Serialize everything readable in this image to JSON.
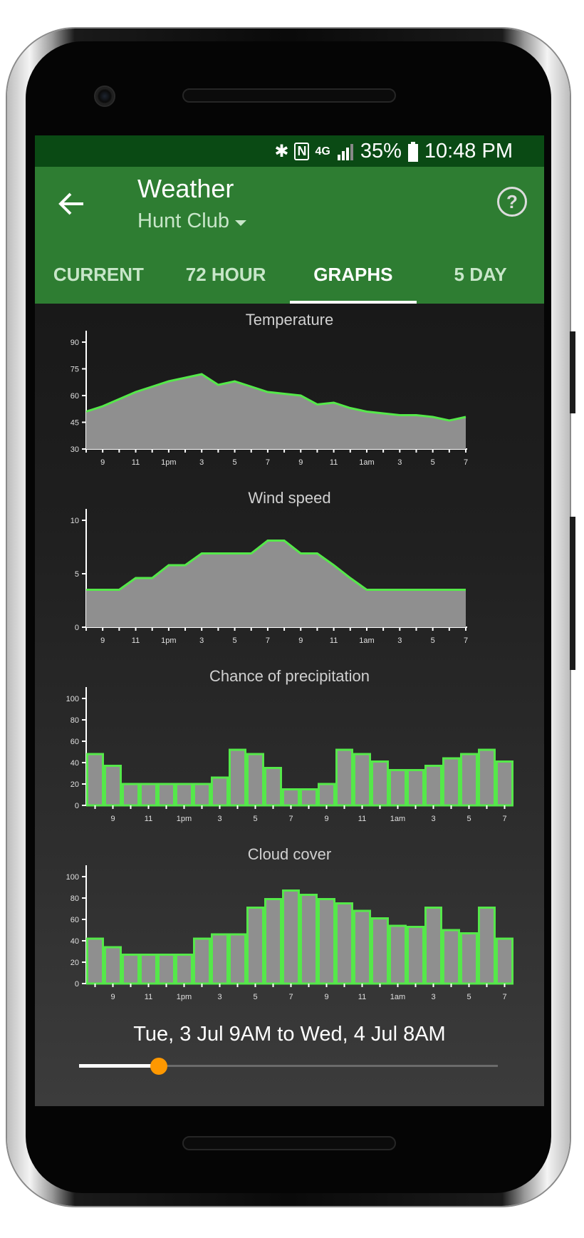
{
  "status_bar": {
    "icons": [
      "bluetooth-icon",
      "nfc-icon",
      "4g-lte-icon",
      "signal-icon",
      "battery-icon"
    ],
    "battery": "35%",
    "time": "10:48 PM"
  },
  "app_bar": {
    "title": "Weather",
    "location": "Hunt Club",
    "back_icon": "arrow-left-icon",
    "help_icon": "help-circle-icon"
  },
  "tabs": [
    {
      "label": "CURRENT",
      "active": false
    },
    {
      "label": "72 HOUR",
      "active": false
    },
    {
      "label": "GRAPHS",
      "active": true
    },
    {
      "label": "5 DAY",
      "active": false
    }
  ],
  "colors": {
    "status_bar": "#0a4a14",
    "app_bar": "#2e7d32",
    "series_line": "#55e84a",
    "series_fill": "#8f8f8f",
    "slider_thumb": "#ff9800"
  },
  "chart_data": [
    {
      "type": "area",
      "title": "Temperature",
      "x_tick_labels": [
        "9",
        "11",
        "1pm",
        "3",
        "5",
        "7",
        "9",
        "11",
        "1am",
        "3",
        "5",
        "7"
      ],
      "x": [
        "8AM",
        "9AM",
        "10AM",
        "11AM",
        "12PM",
        "1PM",
        "2PM",
        "3PM",
        "4PM",
        "5PM",
        "6PM",
        "7PM",
        "8PM",
        "9PM",
        "10PM",
        "11PM",
        "12AM",
        "1AM",
        "2AM",
        "3AM",
        "4AM",
        "5AM",
        "6AM",
        "7AM",
        "8AM"
      ],
      "values": [
        51,
        54,
        58,
        62,
        65,
        68,
        70,
        72,
        66,
        68,
        65,
        62,
        61,
        60,
        55,
        56,
        53,
        51,
        50,
        49,
        49,
        48,
        46,
        48
      ],
      "ylim": [
        30,
        90
      ],
      "yticks": [
        30,
        45,
        60,
        75,
        90
      ],
      "xlabel": "",
      "ylabel": ""
    },
    {
      "type": "area",
      "title": "Wind speed",
      "x_tick_labels": [
        "9",
        "11",
        "1pm",
        "3",
        "5",
        "7",
        "9",
        "11",
        "1am",
        "3",
        "5",
        "7"
      ],
      "values": [
        3.5,
        3.5,
        3.5,
        4.6,
        4.6,
        5.8,
        5.8,
        6.9,
        6.9,
        6.9,
        6.9,
        8.1,
        8.1,
        6.9,
        6.9,
        5.8,
        4.6,
        3.5,
        3.5,
        3.5,
        3.5,
        3.5,
        3.5,
        3.5
      ],
      "ylim": [
        0,
        10
      ],
      "yticks": [
        0,
        5,
        10
      ],
      "xlabel": "",
      "ylabel": ""
    },
    {
      "type": "bar",
      "title": "Chance of precipitation",
      "x_tick_labels": [
        "9",
        "11",
        "1pm",
        "3",
        "5",
        "7",
        "9",
        "11",
        "1am",
        "3",
        "5",
        "7"
      ],
      "values": [
        48,
        37,
        20,
        20,
        20,
        20,
        20,
        26,
        52,
        48,
        35,
        15,
        15,
        20,
        52,
        48,
        41,
        33,
        33,
        37,
        44,
        48,
        52,
        41
      ],
      "ylim": [
        0,
        100
      ],
      "yticks": [
        0,
        20,
        40,
        60,
        80,
        100
      ],
      "xlabel": "",
      "ylabel": ""
    },
    {
      "type": "bar",
      "title": "Cloud cover",
      "x_tick_labels": [
        "9",
        "11",
        "1pm",
        "3",
        "5",
        "7",
        "9",
        "11",
        "1am",
        "3",
        "5",
        "7"
      ],
      "values": [
        42,
        34,
        27,
        27,
        27,
        27,
        42,
        46,
        46,
        71,
        79,
        87,
        83,
        79,
        75,
        68,
        61,
        54,
        53,
        71,
        50,
        47,
        71,
        42
      ],
      "ylim": [
        0,
        100
      ],
      "yticks": [
        0,
        20,
        40,
        60,
        80,
        100
      ],
      "xlabel": "",
      "ylabel": ""
    }
  ],
  "range": {
    "label": "Tue, 3 Jul 9AM to Wed, 4 Jul 8AM",
    "slider_value": 0.19
  }
}
